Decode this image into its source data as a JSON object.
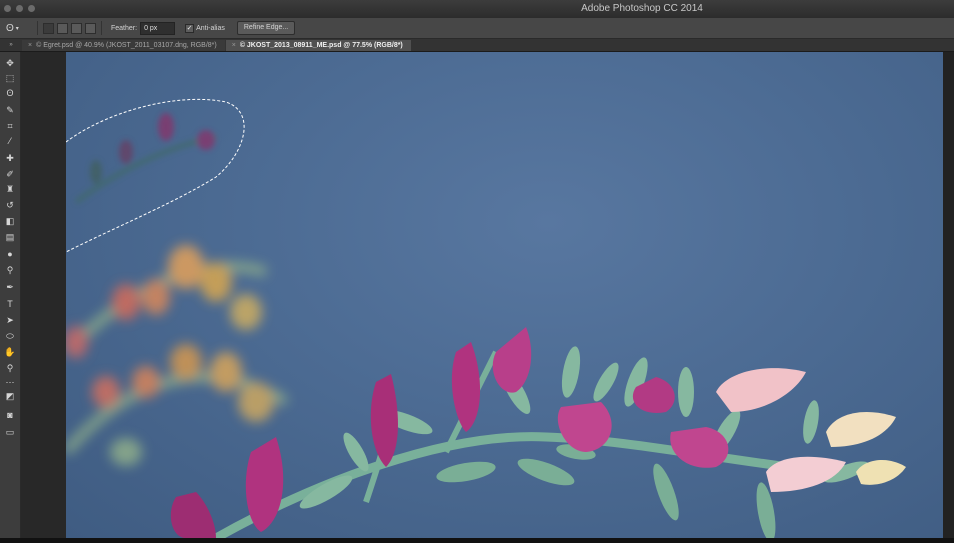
{
  "window": {
    "title": "Adobe Photoshop CC 2014"
  },
  "options_bar": {
    "active_tool_icon": "lasso-icon",
    "feather_label": "Feather:",
    "feather_value": "0 px",
    "antialias_label": "Anti-alias",
    "antialias_checked": true,
    "refine_edge_label": "Refine Edge..."
  },
  "tabs": [
    {
      "close": "×",
      "label": "© Egret.psd @ 40.9% (JKOST_2011_03107.dng, RGB/8*)",
      "active": false
    },
    {
      "close": "×",
      "label": "© JKOST_2013_08911_ME.psd @ 77.5% (RGB/8*)",
      "active": true
    }
  ],
  "tools": [
    {
      "name": "move-tool",
      "icon": "move-icon",
      "glyph": "✥"
    },
    {
      "name": "marquee-tool",
      "icon": "marquee-icon",
      "glyph": "⬚"
    },
    {
      "name": "lasso-tool",
      "icon": "lasso-icon",
      "glyph": "ʘ"
    },
    {
      "name": "quick-selection-tool",
      "icon": "quick-selection-icon",
      "glyph": "✎"
    },
    {
      "name": "crop-tool",
      "icon": "crop-icon",
      "glyph": "⌗"
    },
    {
      "name": "eyedropper-tool",
      "icon": "eyedropper-icon",
      "glyph": "⁄"
    },
    {
      "name": "healing-brush-tool",
      "icon": "bandage-icon",
      "glyph": "✚"
    },
    {
      "name": "brush-tool",
      "icon": "brush-icon",
      "glyph": "✐"
    },
    {
      "name": "clone-stamp-tool",
      "icon": "stamp-icon",
      "glyph": "♜"
    },
    {
      "name": "history-brush-tool",
      "icon": "history-brush-icon",
      "glyph": "↺"
    },
    {
      "name": "eraser-tool",
      "icon": "eraser-icon",
      "glyph": "◧"
    },
    {
      "name": "gradient-tool",
      "icon": "gradient-icon",
      "glyph": "▤"
    },
    {
      "name": "blur-tool",
      "icon": "droplet-icon",
      "glyph": "●"
    },
    {
      "name": "dodge-tool",
      "icon": "dodge-icon",
      "glyph": "⚲"
    },
    {
      "name": "pen-tool",
      "icon": "pen-icon",
      "glyph": "✒"
    },
    {
      "name": "type-tool",
      "icon": "type-icon",
      "glyph": "T"
    },
    {
      "name": "path-selection-tool",
      "icon": "arrow-icon",
      "glyph": "➤"
    },
    {
      "name": "shape-tool",
      "icon": "ellipse-icon",
      "glyph": "⬭"
    },
    {
      "name": "hand-tool",
      "icon": "hand-icon",
      "glyph": "✋"
    },
    {
      "name": "zoom-tool",
      "icon": "magnifier-icon",
      "glyph": "⚲"
    },
    {
      "name": "more-tools",
      "icon": "ellipsis-icon",
      "glyph": "⋯"
    },
    {
      "name": "color-swatches",
      "icon": "swatches-icon",
      "glyph": "◩"
    },
    {
      "name": "quick-mask-mode",
      "icon": "quick-mask-icon",
      "glyph": "◙"
    },
    {
      "name": "screen-mode",
      "icon": "screen-mode-icon",
      "glyph": "▭"
    }
  ],
  "colors": {
    "canvas_bg": "#4c6b93",
    "flower_magenta": "#b0337f",
    "stem_green": "#6fa58e"
  }
}
